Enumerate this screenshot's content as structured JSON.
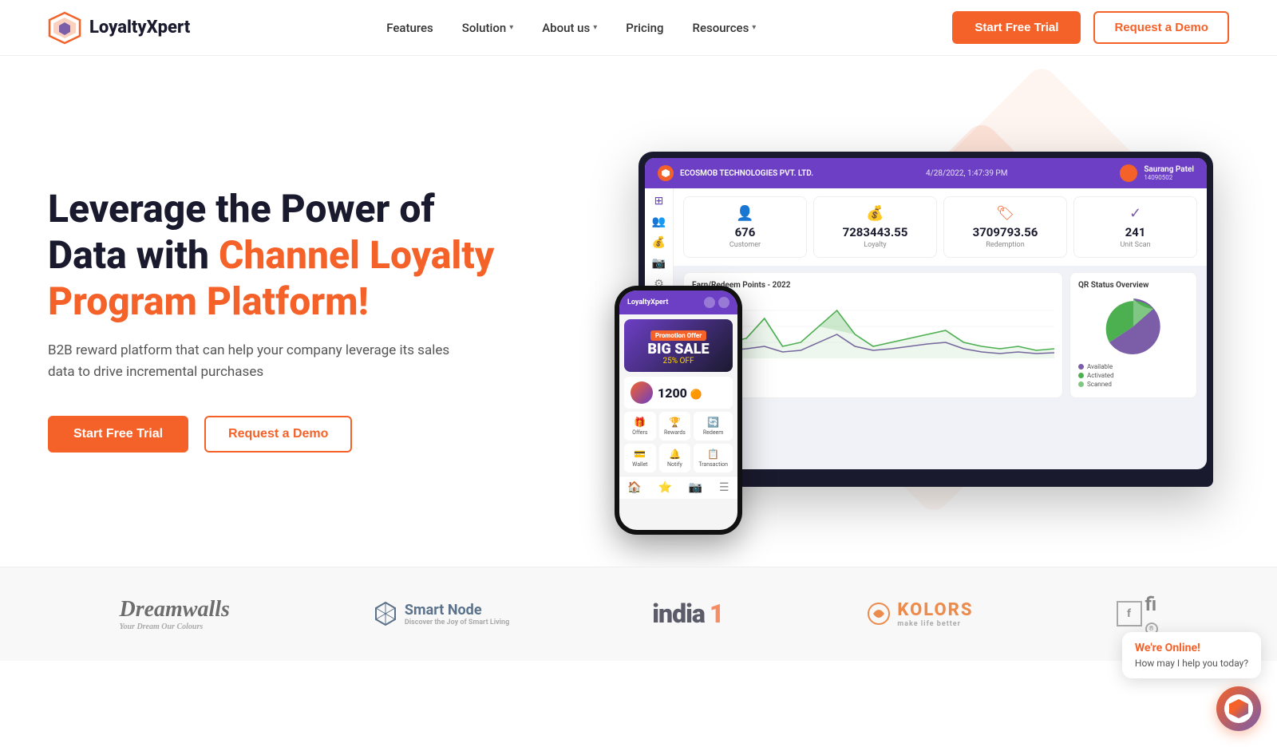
{
  "brand": {
    "name": "LoyaltyXpert",
    "name_part1": "Loyalty",
    "name_part2": "Xpert"
  },
  "nav": {
    "logo_text": "LoyaltyXpert",
    "links": [
      {
        "label": "Features",
        "has_dropdown": false
      },
      {
        "label": "Solution",
        "has_dropdown": true
      },
      {
        "label": "About us",
        "has_dropdown": true
      },
      {
        "label": "Pricing",
        "has_dropdown": false
      },
      {
        "label": "Resources",
        "has_dropdown": true
      }
    ],
    "cta_primary": "Start Free Trial",
    "cta_secondary": "Request a Demo"
  },
  "hero": {
    "title_line1": "Leverage the Power of",
    "title_line2": "Data with ",
    "title_accent": "Channel Loyalty Program Platform!",
    "subtitle": "B2B reward platform that can help your company leverage its sales data to drive incremental purchases",
    "btn_primary": "Start Free Trial",
    "btn_secondary": "Request a Demo"
  },
  "dashboard": {
    "company": "ECOSMOB TECHNOLOGIES PVT. LTD.",
    "date": "4/28/2022, 1:47:39 PM",
    "user": "Saurang Patel",
    "user_id": "14090502",
    "stats": [
      {
        "label": "Customer",
        "value": "676",
        "icon": "👤"
      },
      {
        "label": "Loyalty",
        "value": "7283443.55",
        "icon": "💰"
      },
      {
        "label": "Redemption",
        "value": "3709793.56",
        "icon": "🏷"
      },
      {
        "label": "Unit Scan",
        "value": "241",
        "icon": "✓"
      }
    ],
    "chart_title": "Earn/Redeem Points - 2022",
    "pie_title": "QR Status Overview",
    "pie_legend": [
      {
        "label": "Available",
        "color": "#7b5ea7"
      },
      {
        "label": "Activated",
        "color": "#4caf50"
      },
      {
        "label": "Scanned",
        "color": "#81c784"
      }
    ]
  },
  "phone": {
    "app_name": "LoyaltyXpert",
    "sale_badge": "Promotion Offer",
    "sale_percent": "BIG SALE",
    "sale_discount": "25% OFF",
    "points_value": "1200",
    "grid_items": [
      {
        "label": "Offers",
        "icon": "🎁"
      },
      {
        "label": "Rewards",
        "icon": "🏆"
      },
      {
        "label": "Redeem",
        "icon": "🔄"
      },
      {
        "label": "Wallet",
        "icon": "💳"
      },
      {
        "label": "Notify",
        "icon": "🔔"
      },
      {
        "label": "Transaction",
        "icon": "📋"
      }
    ],
    "nav_items": [
      {
        "label": "Home",
        "icon": "🏠",
        "active": true
      },
      {
        "label": "Loyalty",
        "icon": "⭐",
        "active": false
      },
      {
        "label": "QR",
        "icon": "📷",
        "active": false
      },
      {
        "label": "More",
        "icon": "☰",
        "active": false
      }
    ]
  },
  "clients": [
    {
      "name": "Dreamwalls",
      "sub": "Your Dream Our Colours",
      "style": "dreamwalls"
    },
    {
      "name": "Smart Node",
      "sub": "Discover the Joy of Smart Living",
      "style": "smartnode"
    },
    {
      "name": "india1",
      "style": "india1"
    },
    {
      "name": "KOLORS",
      "sub": "make life better",
      "style": "kolors"
    },
    {
      "name": "fi",
      "style": "brand5"
    }
  ],
  "chat": {
    "status": "We're Online!",
    "message": "How may I help you today?"
  }
}
